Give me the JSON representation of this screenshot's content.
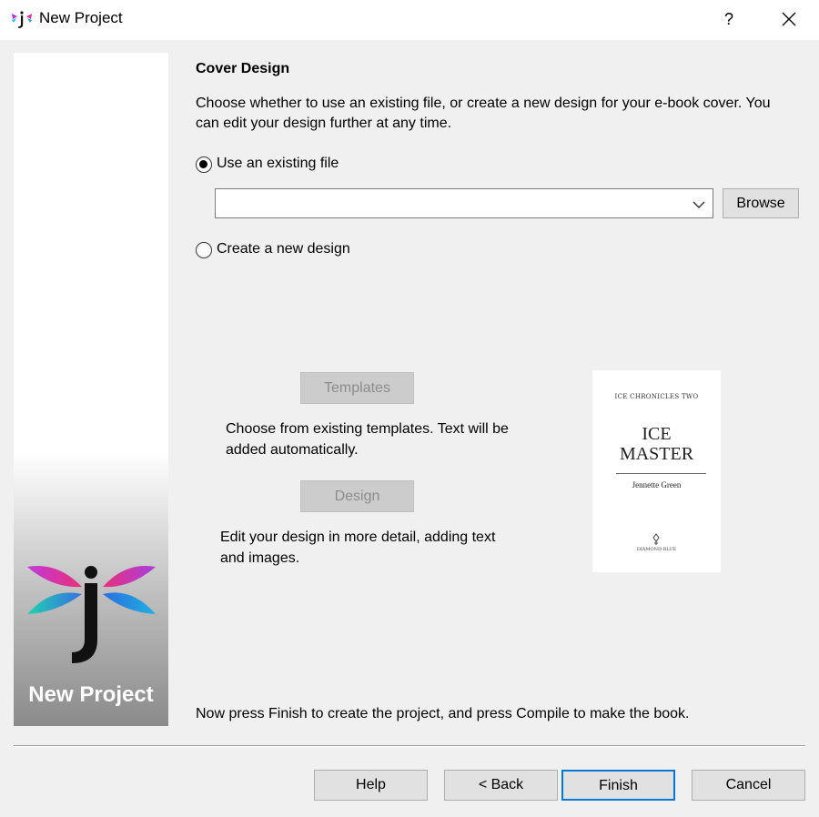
{
  "window": {
    "title": "New Project",
    "help_label": "?",
    "icons": {
      "app": "jutoh-logo-icon",
      "close": "close-icon"
    }
  },
  "banner": {
    "title": "New Project",
    "logo": "jutoh-dragonfly-logo"
  },
  "content": {
    "section_title": "Cover Design",
    "description": "Choose whether to use an existing file, or create a new design for your e-book cover. You can edit your design further at any time.",
    "option_existing": {
      "label": "Use an existing file",
      "selected": true
    },
    "file_combo": {
      "value": ""
    },
    "browse_label": "Browse",
    "option_new": {
      "label": "Create a new design",
      "selected": false
    },
    "templates_label": "Templates",
    "templates_description": "Choose from existing templates. Text will be added automatically.",
    "design_label": "Design",
    "design_description": "Edit your design in more detail, adding text and images.",
    "cover_preview": {
      "series": "ICE CHRONICLES TWO",
      "title_line1": "ICE",
      "title_line2": "MASTER",
      "author": "Jennette Green",
      "publisher": "DIAMOND BLUE"
    },
    "instruction": "Now press Finish to create the project, and press Compile to make the book."
  },
  "footer": {
    "help_label": "Help",
    "back_label": "< Back",
    "finish_label": "Finish",
    "cancel_label": "Cancel"
  },
  "colors": {
    "accent": "#0078d7",
    "dialog_bg": "#f0f0f0"
  }
}
